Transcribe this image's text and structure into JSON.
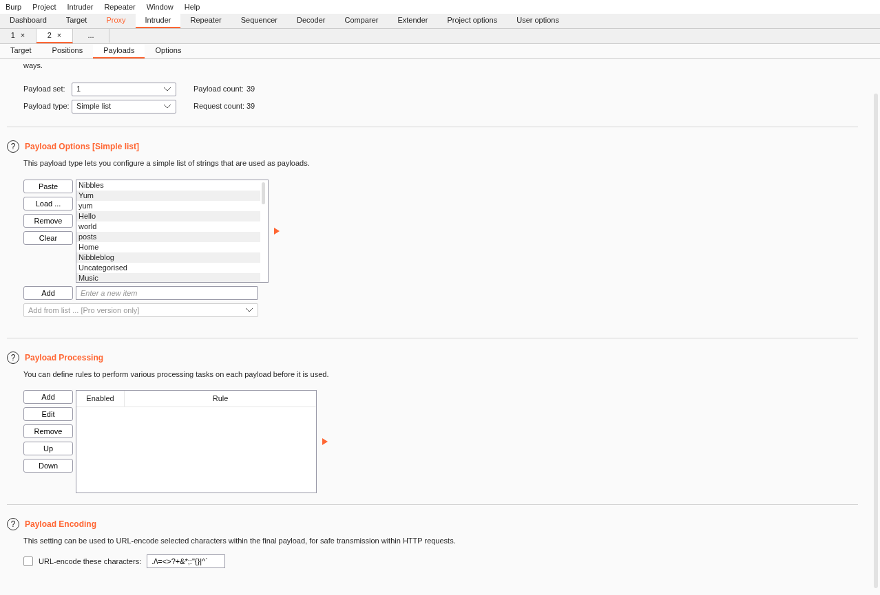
{
  "menu": [
    "Burp",
    "Project",
    "Intruder",
    "Repeater",
    "Window",
    "Help"
  ],
  "main_tabs": [
    {
      "label": "Dashboard",
      "selected": false,
      "highlighted": false
    },
    {
      "label": "Target",
      "selected": false,
      "highlighted": false
    },
    {
      "label": "Proxy",
      "selected": false,
      "highlighted": true
    },
    {
      "label": "Intruder",
      "selected": true,
      "highlighted": false
    },
    {
      "label": "Repeater",
      "selected": false,
      "highlighted": false
    },
    {
      "label": "Sequencer",
      "selected": false,
      "highlighted": false
    },
    {
      "label": "Decoder",
      "selected": false,
      "highlighted": false
    },
    {
      "label": "Comparer",
      "selected": false,
      "highlighted": false
    },
    {
      "label": "Extender",
      "selected": false,
      "highlighted": false
    },
    {
      "label": "Project options",
      "selected": false,
      "highlighted": false
    },
    {
      "label": "User options",
      "selected": false,
      "highlighted": false
    }
  ],
  "attack_tabs": [
    {
      "label": "1",
      "close": "×",
      "selected": false
    },
    {
      "label": "2",
      "close": "×",
      "selected": true
    },
    {
      "label": "...",
      "selected": false
    }
  ],
  "sub_tabs": [
    {
      "label": "Target",
      "selected": false
    },
    {
      "label": "Positions",
      "selected": false
    },
    {
      "label": "Payloads",
      "selected": true
    },
    {
      "label": "Options",
      "selected": false
    }
  ],
  "intro_tail": "ways.",
  "payload_sets": {
    "set_label": "Payload set:",
    "set_value": "1",
    "type_label": "Payload type:",
    "type_value": "Simple list",
    "count_label": "Payload count:",
    "count_value": "39",
    "request_label": "Request count:",
    "request_value": "39"
  },
  "payload_options": {
    "help": "?",
    "title": "Payload Options [Simple list]",
    "description": "This payload type lets you configure a simple list of strings that are used as payloads.",
    "buttons": [
      "Paste",
      "Load ...",
      "Remove",
      "Clear"
    ],
    "items": [
      "Nibbles",
      "Yum",
      "yum",
      "Hello",
      "world",
      "posts",
      "Home",
      "Nibbleblog",
      "Uncategorised",
      "Music"
    ],
    "add_button": "Add",
    "add_placeholder": "Enter a new item",
    "add_from_list": "Add from list ... [Pro version only]"
  },
  "payload_processing": {
    "help": "?",
    "title": "Payload Processing",
    "description": "You can define rules to perform various processing tasks on each payload before it is used.",
    "buttons": [
      "Add",
      "Edit",
      "Remove",
      "Up",
      "Down"
    ],
    "columns": [
      "Enabled",
      "Rule"
    ]
  },
  "payload_encoding": {
    "help": "?",
    "title": "Payload Encoding",
    "description": "This setting can be used to URL-encode selected characters within the final payload, for safe transmission within HTTP requests.",
    "checkbox_label": "URL-encode these characters:",
    "checked": false,
    "characters": "./\\=<>?+&*;:\"{}|^`"
  }
}
